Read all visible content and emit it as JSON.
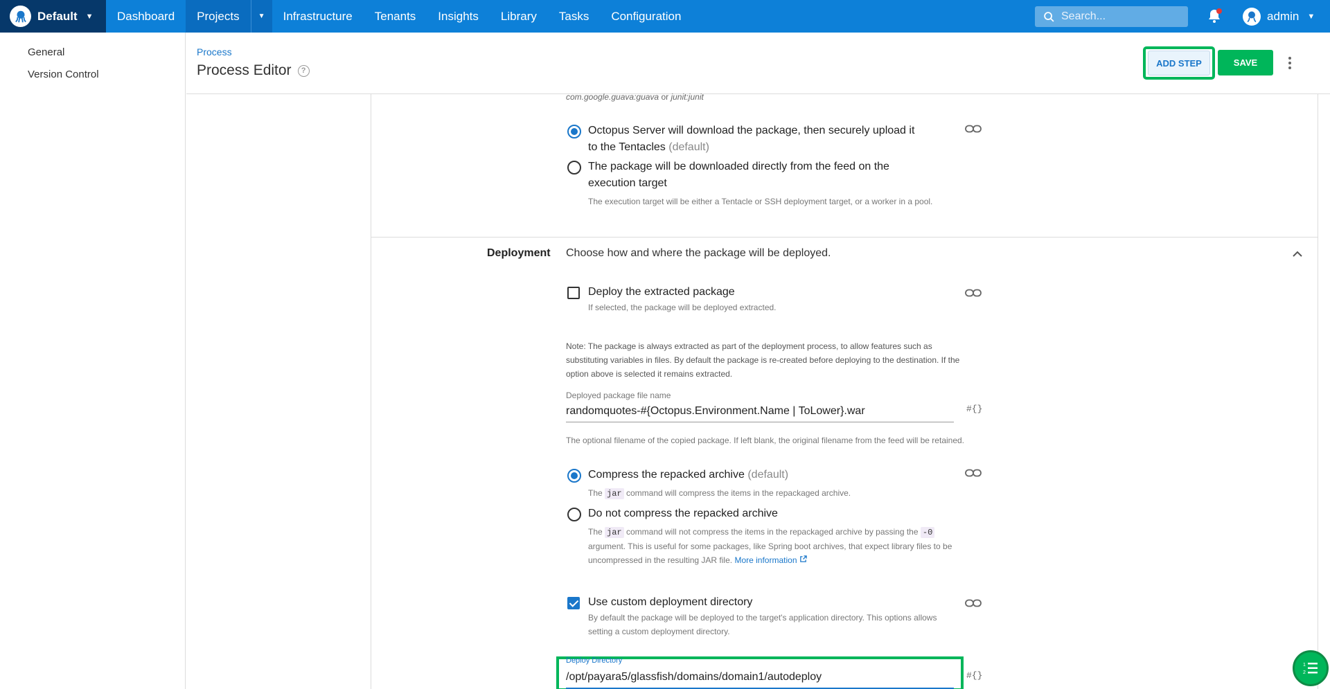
{
  "topnav": {
    "space_name": "Default",
    "items": [
      "Dashboard",
      "Projects",
      "Infrastructure",
      "Tenants",
      "Insights",
      "Library",
      "Tasks",
      "Configuration"
    ],
    "search_placeholder": "Search...",
    "user_name": "admin"
  },
  "sidebar": {
    "items": [
      "General",
      "Version Control"
    ]
  },
  "header": {
    "breadcrumb": "Process",
    "title": "Process Editor",
    "add_step_label": "ADD STEP",
    "save_label": "SAVE"
  },
  "acquisition": {
    "top_hint_part1": "com.google.guava:guava",
    "top_hint_or": " or ",
    "top_hint_part2": "junit:junit",
    "option_server_label": "Octopus Server will download the package, then securely upload it to the Tentacles",
    "option_server_default": "(default)",
    "option_direct_label": "The package will be downloaded directly from the feed on the execution target",
    "option_direct_help": "The execution target will be either a Tentacle or SSH deployment target, or a worker in a pool."
  },
  "deployment": {
    "label": "Deployment",
    "description": "Choose how and where the package will be deployed.",
    "extracted_label": "Deploy the extracted package",
    "extracted_help": "If selected, the package will be deployed extracted.",
    "note": "Note: The package is always extracted as part of the deployment process, to allow features such as substituting variables in files. By default the package is re-created before deploying to the destination. If the option above is selected it remains extracted.",
    "file_name_label": "Deployed package file name",
    "file_name_value": "randomquotes-#{Octopus.Environment.Name | ToLower}.war",
    "file_name_help": "The optional filename of the copied package. If left blank, the original filename from the feed will be retained.",
    "compress_label": "Compress the repacked archive",
    "compress_default": "(default)",
    "compress_help_pre": "The",
    "compress_help_code": "jar",
    "compress_help_post": "command will compress the items in the repackaged archive.",
    "nocompress_label": "Do not compress the repacked archive",
    "nocompress_help_pre": "The",
    "nocompress_help_code": "jar",
    "nocompress_help_mid": "command will not compress the items in the repackaged archive by passing the",
    "nocompress_help_code2": "-0",
    "nocompress_help_post": "argument. This is useful for some packages, like Spring boot archives, that expect library files to be uncompressed in the resulting JAR file.",
    "more_info": "More information",
    "custom_dir_label": "Use custom deployment directory",
    "custom_dir_help": "By default the package will be deployed to the target's application directory. This options allows setting a custom deployment directory.",
    "deploy_dir_label": "Deploy Directory",
    "deploy_dir_value": "/opt/payara5/glassfish/domains/domain1/autodeploy",
    "var_button": "#{}"
  },
  "colors": {
    "nav_blue": "#0d80d8",
    "space_navy": "#06386a",
    "accent_green": "#00b65a",
    "link_blue": "#1a77ca"
  }
}
